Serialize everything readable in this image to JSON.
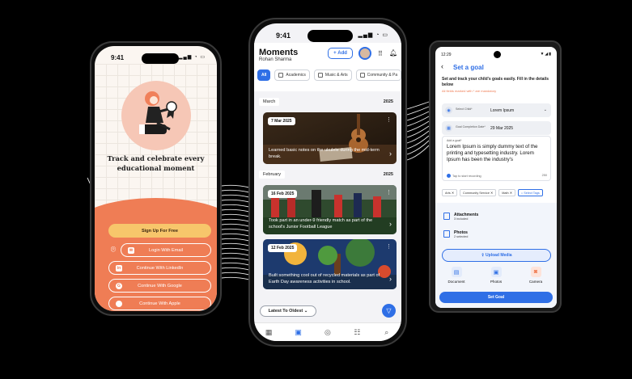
{
  "onboarding": {
    "time": "9:41",
    "tagline": "Track and celebrate every educational moment",
    "buttons": {
      "signup": "Sign Up For Free",
      "email": "Login With Email",
      "linkedin": "Continue With LinkedIn",
      "google": "Continue With Google",
      "apple": "Continue With Apple"
    }
  },
  "moments": {
    "time": "9:41",
    "title": "Moments",
    "user": "Rohan Sharma",
    "add_label": "Add",
    "filters": [
      "All",
      "Academics",
      "Music & Arts",
      "Community & Pa"
    ],
    "months": [
      {
        "name": "March",
        "year": "2025"
      },
      {
        "name": "February",
        "year": "2025"
      }
    ],
    "cards": [
      {
        "date": "7 Mar 2025",
        "caption": "Learned basic notes on the ukulele during the mid-term break."
      },
      {
        "date": "16 Feb 2025",
        "caption": "Took part in an under-9 friendly match as part of the school's Junior Football League"
      },
      {
        "date": "12 Feb 2025",
        "caption": "Built something cool out of recycled materials as part of Earth Day awareness activities in school."
      }
    ],
    "sort_label": "Latest To Oldest",
    "colors": {
      "accent": "#2f6fe6"
    }
  },
  "goal": {
    "time": "12:29",
    "title": "Set a goal",
    "description": "Set and track your child's goals easily. Fill in the details below",
    "required_note": "All fields marked with * are mandatory",
    "child_field": {
      "label": "Select Child*",
      "value": "Lorem Ipsum"
    },
    "date_field": {
      "label": "Goal Completion Date*",
      "value": "29 Mar 2025"
    },
    "goal_field": {
      "label": "Add a goal*",
      "value": "Lorem Ipsum is simply dummy text of the printing and typesetting industry. Lorem Ipsum has been the industry's",
      "mic_hint": "Tap to start recording",
      "count": "250"
    },
    "tags": [
      "Arts",
      "Community Service",
      "Math",
      "Select Tags"
    ],
    "attachments": {
      "label": "Attachments",
      "sub": "3 included"
    },
    "photos": {
      "label": "Photos",
      "sub": "2 selected"
    },
    "upload_label": "Upload Media",
    "media_options": [
      "Document",
      "Photos",
      "Camera"
    ],
    "submit_label": "Set Goal"
  }
}
